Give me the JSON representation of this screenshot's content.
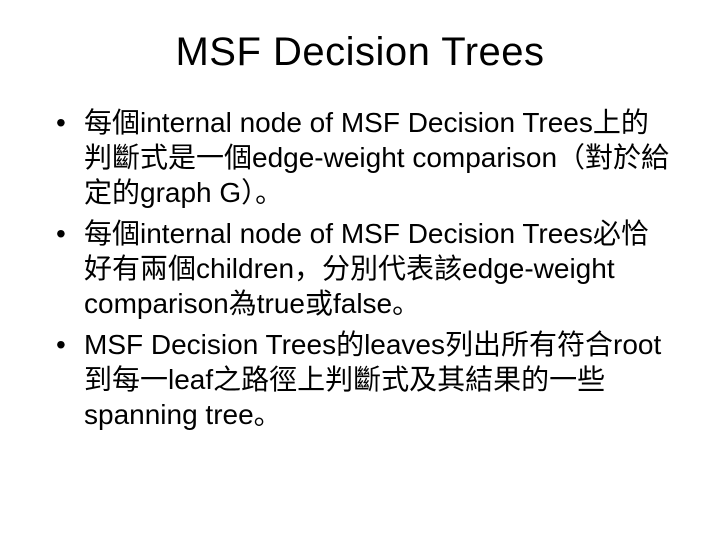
{
  "title": "MSF Decision Trees",
  "bullets": [
    "每個internal node of MSF Decision Trees上的判斷式是一個edge-weight comparison（對於給定的graph G）。",
    "每個internal node of MSF Decision Trees必恰好有兩個children，分別代表該edge-weight comparison為true或false。",
    "MSF Decision Trees的leaves列出所有符合root到每一leaf之路徑上判斷式及其結果的一些spanning tree。"
  ]
}
